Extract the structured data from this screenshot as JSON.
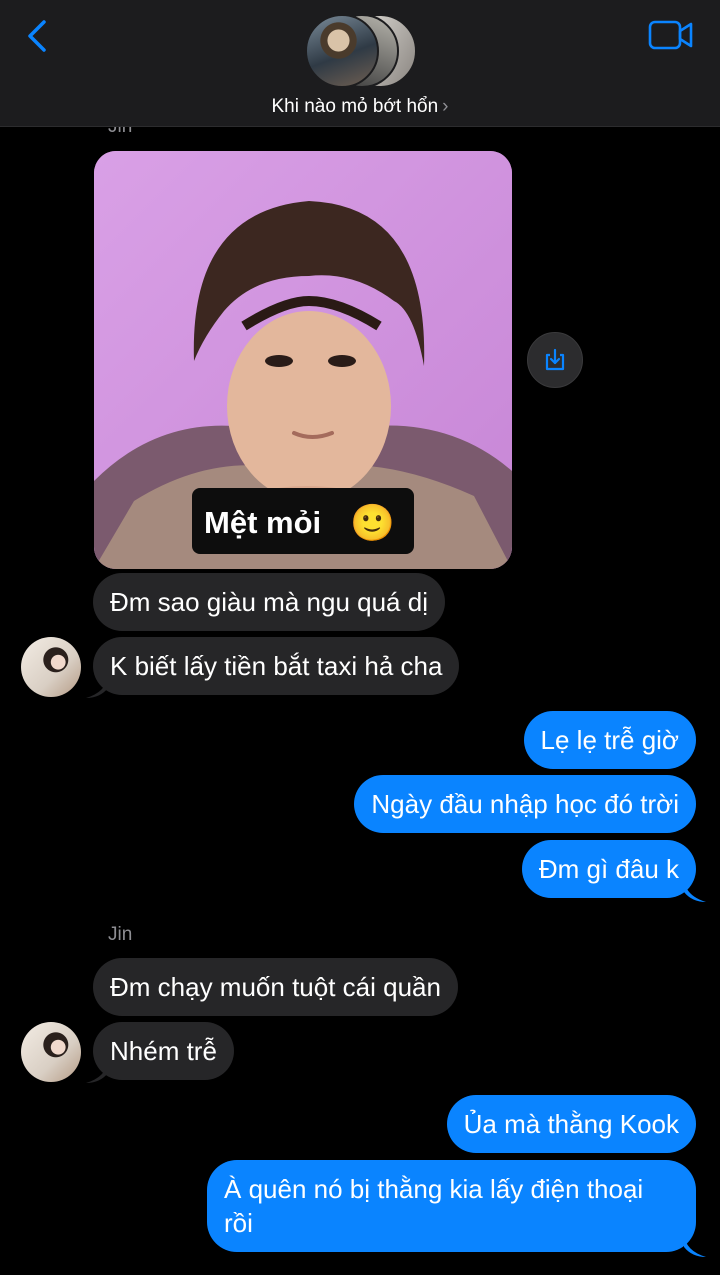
{
  "header": {
    "group_name": "Khi nào mỏ bớt hổn",
    "chevron": "›",
    "icons": [
      "back-chevron-icon",
      "video-call-icon"
    ],
    "accent_color": "#0a84ff"
  },
  "messages": {
    "sender_top": "Jin",
    "photo_caption": "Mệt mỏi",
    "photo_emoji": "🙂",
    "in_1": "Đm sao giàu mà ngu quá dị",
    "in_2": "K biết lấy tiền bắt taxi hả cha",
    "out_1": "Lẹ lẹ trễ giờ",
    "out_2": "Ngày đầu nhập học đó trời",
    "out_3": "Đm gì đâu k",
    "sender_2": "Jin",
    "in_3": "Đm chạy muốn tuột cái quần",
    "in_4": "Nhém trễ",
    "out_4": "Ủa mà thằng Kook",
    "out_5": "À quên nó bị thằng kia lấy điện thoại rồi"
  }
}
